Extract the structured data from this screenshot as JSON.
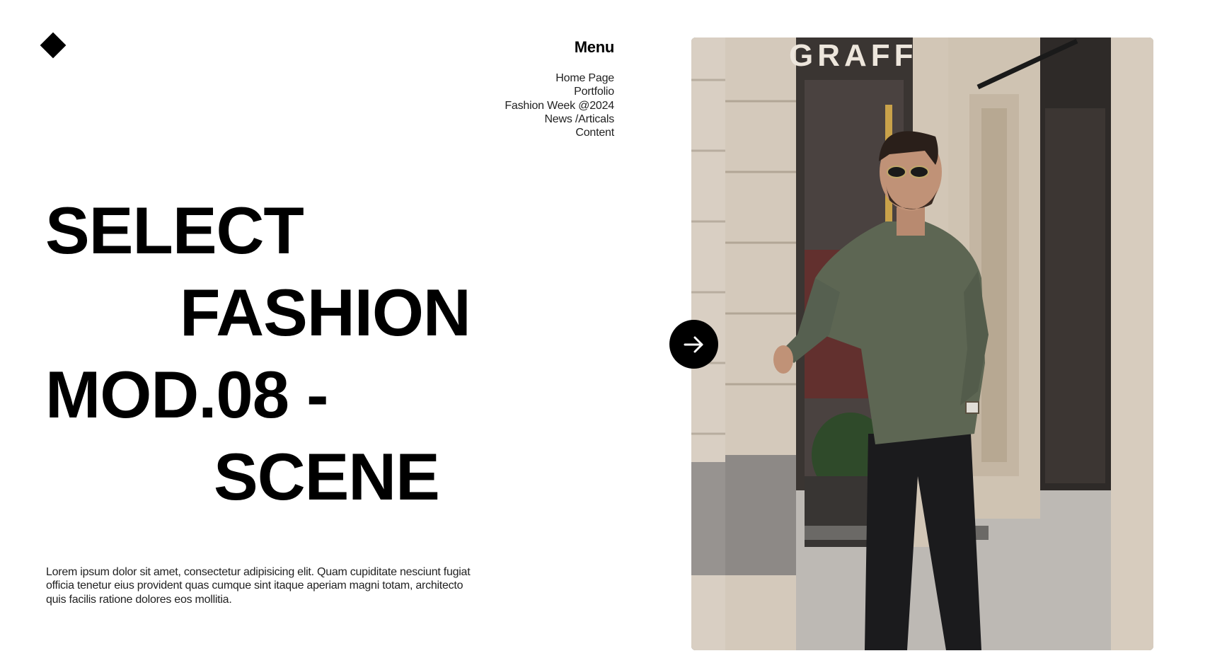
{
  "menu": {
    "title": "Menu",
    "items": [
      {
        "label": "Home Page"
      },
      {
        "label": "Portfolio"
      },
      {
        "label": "Fashion Week @2024"
      },
      {
        "label": "News /Articals"
      },
      {
        "label": "Content"
      }
    ]
  },
  "headline": {
    "line1": "SELECT",
    "line2": "FASHION",
    "line3": "MOD.08 -",
    "line4": "SCENE"
  },
  "description": "Lorem ipsum dolor sit amet, consectetur adipisicing elit. Quam cupiditate nesciunt fugiat officia tenetur eius provident quas cumque sint itaque aperiam magni totam, architecto quis facilis ratione dolores eos mollitia.",
  "hero": {
    "storefront_sign": "GRAFF"
  },
  "icons": {
    "logo": "diamond-logo-icon",
    "next": "arrow-right-icon"
  }
}
